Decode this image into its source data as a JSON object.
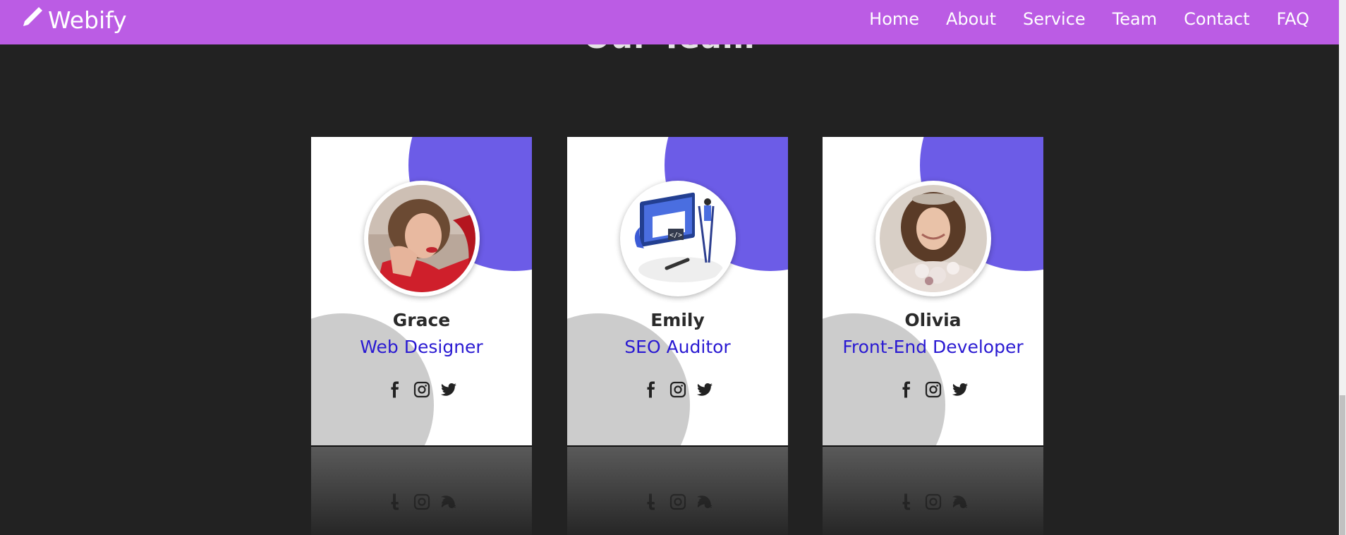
{
  "brand": {
    "name": "Webify",
    "icon": "pencil-icon"
  },
  "nav": {
    "links": [
      "Home",
      "About",
      "Service",
      "Team",
      "Contact",
      "FAQ"
    ]
  },
  "section": {
    "title": "Our Team"
  },
  "colors": {
    "navbar": "#bb5ce4",
    "accent_circle": "#6c5ce7",
    "role_text": "#2a1ad2",
    "page_bg": "#222222"
  },
  "team": [
    {
      "name": "Grace",
      "role": "Web Designer",
      "avatar": "woman-red-jacket-photo"
    },
    {
      "name": "Emily",
      "role": "SEO Auditor",
      "avatar": "web-developer-illustration"
    },
    {
      "name": "Olivia",
      "role": "Front-End Developer",
      "avatar": "bride-portrait-photo"
    }
  ],
  "social_icons": [
    "facebook-icon",
    "instagram-icon",
    "twitter-icon"
  ]
}
